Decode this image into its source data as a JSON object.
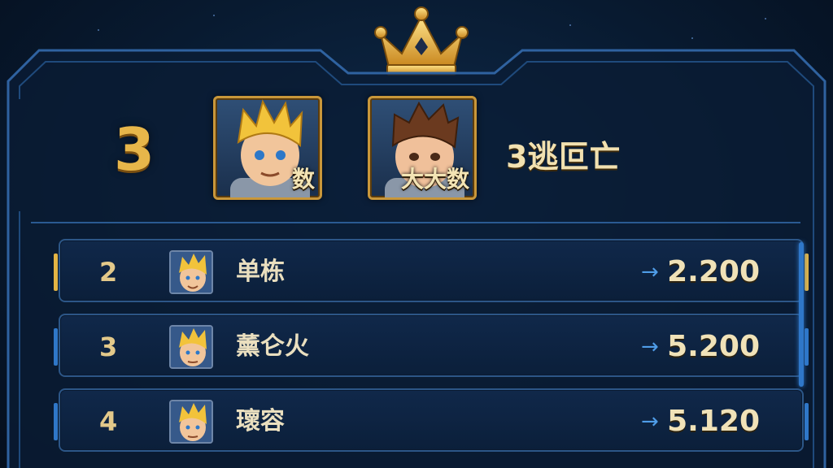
{
  "header": {
    "rank": "3",
    "portraits": [
      {
        "tag": "数",
        "hair": "#f2c33b"
      },
      {
        "tag": "大大数",
        "hair": "#6b3a1f"
      }
    ],
    "title": "3逃叵亡"
  },
  "leaderboard": {
    "rows": [
      {
        "rank": "2",
        "name": "单栋",
        "arrow": "→",
        "score": "2.200",
        "highlight": "gold"
      },
      {
        "rank": "3",
        "name": "薰仑火",
        "arrow": "→",
        "score": "5.200",
        "highlight": "blue"
      },
      {
        "rank": "4",
        "name": "瓌容",
        "arrow": "→",
        "score": "5.120",
        "highlight": "blue"
      }
    ]
  },
  "colors": {
    "gold": "#e7b64a",
    "frame": "#2c5687",
    "accent": "#4f9de8"
  }
}
